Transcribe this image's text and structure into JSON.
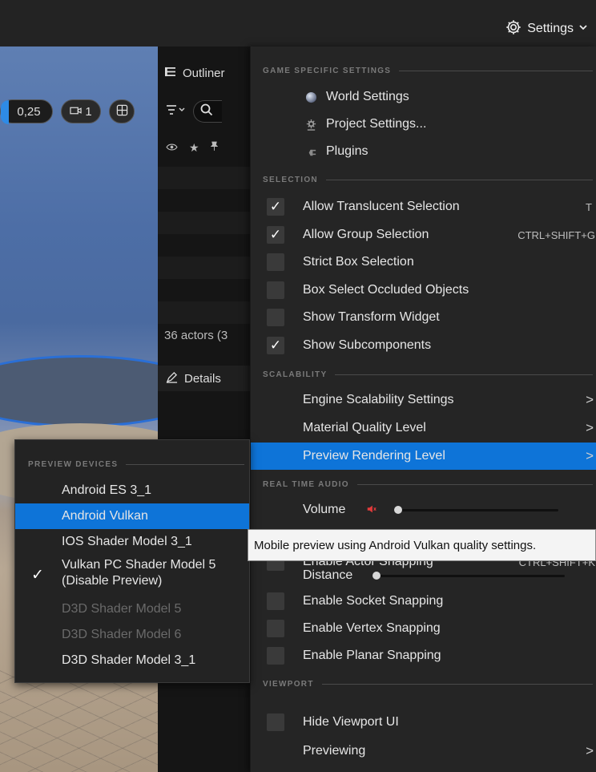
{
  "topbar": {
    "settings_label": "Settings",
    "settings_icon": "gear-icon",
    "chevron_icon": "chevron-down-icon"
  },
  "viewport": {
    "snap_value": "0,25",
    "camera_label": "1",
    "camera_icon": "camera-icon",
    "layout_icon": "viewport-layout-icon"
  },
  "outliner": {
    "title": "Outliner",
    "actor_count": "36 actors (3",
    "details_label": "Details"
  },
  "settings_menu": {
    "sections": {
      "game_specific": "GAME SPECIFIC SETTINGS",
      "selection": "SELECTION",
      "scalability": "SCALABILITY",
      "real_time_audio": "REAL TIME AUDIO",
      "viewport": "VIEWPORT"
    },
    "game_items": [
      {
        "label": "World Settings",
        "icon": "world-sphere-icon"
      },
      {
        "label": "Project Settings...",
        "icon": "project-gear-icon"
      },
      {
        "label": "Plugins",
        "icon": "plug-icon"
      }
    ],
    "selection_items": [
      {
        "label": "Allow Translucent Selection",
        "checked": true,
        "shortcut": "T"
      },
      {
        "label": "Allow Group Selection",
        "checked": true,
        "shortcut": "CTRL+SHIFT+G"
      },
      {
        "label": "Strict Box Selection",
        "checked": false,
        "shortcut": ""
      },
      {
        "label": "Box Select Occluded Objects",
        "checked": false,
        "shortcut": ""
      },
      {
        "label": "Show Transform Widget",
        "checked": false,
        "shortcut": ""
      },
      {
        "label": "Show Subcomponents",
        "checked": true,
        "shortcut": ""
      }
    ],
    "scalability_items": [
      {
        "label": "Engine Scalability Settings"
      },
      {
        "label": "Material Quality Level"
      },
      {
        "label": "Preview Rendering Level"
      }
    ],
    "audio": {
      "volume_label": "Volume",
      "volume_level": 0.02
    },
    "snapping": {
      "actor_snapping_label": "Enable Actor Snapping",
      "actor_snapping_shortcut": "CTRL+SHIFT+K",
      "distance_label": "Distance",
      "distance_level": 0.02,
      "items": [
        {
          "label": "Enable Socket Snapping",
          "checked": false
        },
        {
          "label": "Enable Vertex Snapping",
          "checked": false
        },
        {
          "label": "Enable Planar Snapping",
          "checked": false
        }
      ]
    },
    "viewport_items": [
      {
        "label": "Hide Viewport UI",
        "checked": false
      },
      {
        "label": "Previewing"
      }
    ]
  },
  "preview_devices": {
    "header": "PREVIEW DEVICES",
    "items": [
      {
        "label": "Android ES 3_1",
        "enabled": true,
        "checked": false
      },
      {
        "label": "Android Vulkan",
        "enabled": true,
        "checked": false,
        "highlighted": true
      },
      {
        "label": "IOS Shader Model 3_1",
        "enabled": true,
        "checked": false
      },
      {
        "label_line1": "Vulkan PC Shader Model 5",
        "label_line2": "(Disable Preview)",
        "enabled": true,
        "checked": true
      },
      {
        "label": "D3D Shader Model 5",
        "enabled": false,
        "checked": false
      },
      {
        "label": "D3D Shader Model 6",
        "enabled": false,
        "checked": false
      },
      {
        "label": "D3D Shader Model 3_1",
        "enabled": true,
        "checked": false
      }
    ]
  },
  "tooltip": {
    "text": "Mobile preview using Android Vulkan quality settings."
  },
  "colors": {
    "highlight": "#0e74d8",
    "menu_bg": "#252525",
    "accent_blue": "#2e8be6"
  }
}
